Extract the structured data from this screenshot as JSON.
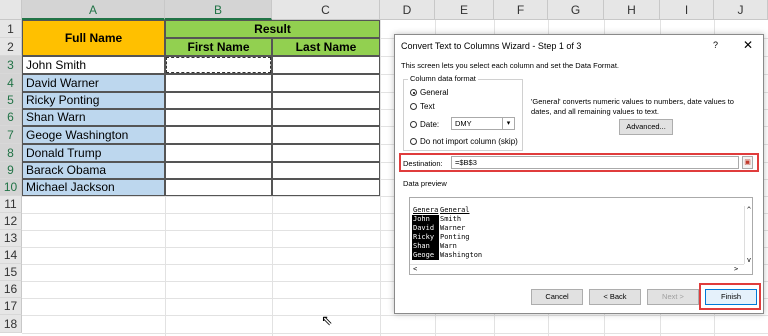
{
  "columns": [
    "A",
    "B",
    "C",
    "D",
    "E",
    "F",
    "G",
    "H",
    "I",
    "J"
  ],
  "rows": [
    "1",
    "2",
    "3",
    "4",
    "5",
    "6",
    "7",
    "8",
    "9",
    "10",
    "11",
    "12",
    "13",
    "14",
    "15",
    "16",
    "17",
    "18"
  ],
  "sheet": {
    "full_name_header": "Full Name",
    "result_header": "Result",
    "first_name_header": "First Name",
    "last_name_header": "Last Name",
    "names": [
      "John Smith",
      "David Warner",
      "Ricky Ponting",
      "Shan Warn",
      "Geoge Washington",
      "Donald Trump",
      "Barack Obama",
      "Michael Jackson"
    ],
    "colors": {
      "header_orange": "#ffc000",
      "header_green": "#92d050",
      "name_blue": "#bdd7ee",
      "grid": "#e2e2e2"
    }
  },
  "dialog": {
    "title": "Convert Text to Columns Wizard - Step 1 of 3",
    "help": "?",
    "close": "✕",
    "description": "This screen lets you select each column and set the Data Format.",
    "column_data_format": "Column data format",
    "radio_general": "General",
    "radio_text": "Text",
    "radio_date": "Date:",
    "date_value": "DMY",
    "radio_skip": "Do not import column (skip)",
    "info_text": "'General' converts numeric values to numbers, date values to dates, and all remaining values to text.",
    "advanced_button": "Advanced...",
    "destination_label": "Destination:",
    "destination_value": "=$B$3",
    "data_preview_label": "Data preview",
    "preview_header": [
      "Genera",
      "General"
    ],
    "preview_rows": [
      [
        "John",
        "Smith"
      ],
      [
        "David",
        "Warner"
      ],
      [
        "Ricky",
        "Ponting"
      ],
      [
        "Shan",
        "Warn"
      ],
      [
        "Geoge",
        "Washington"
      ]
    ],
    "cancel_button": "Cancel",
    "back_button": "< Back",
    "next_button": "Next >",
    "finish_button": "Finish",
    "highlight_color": "#e03c3c"
  }
}
